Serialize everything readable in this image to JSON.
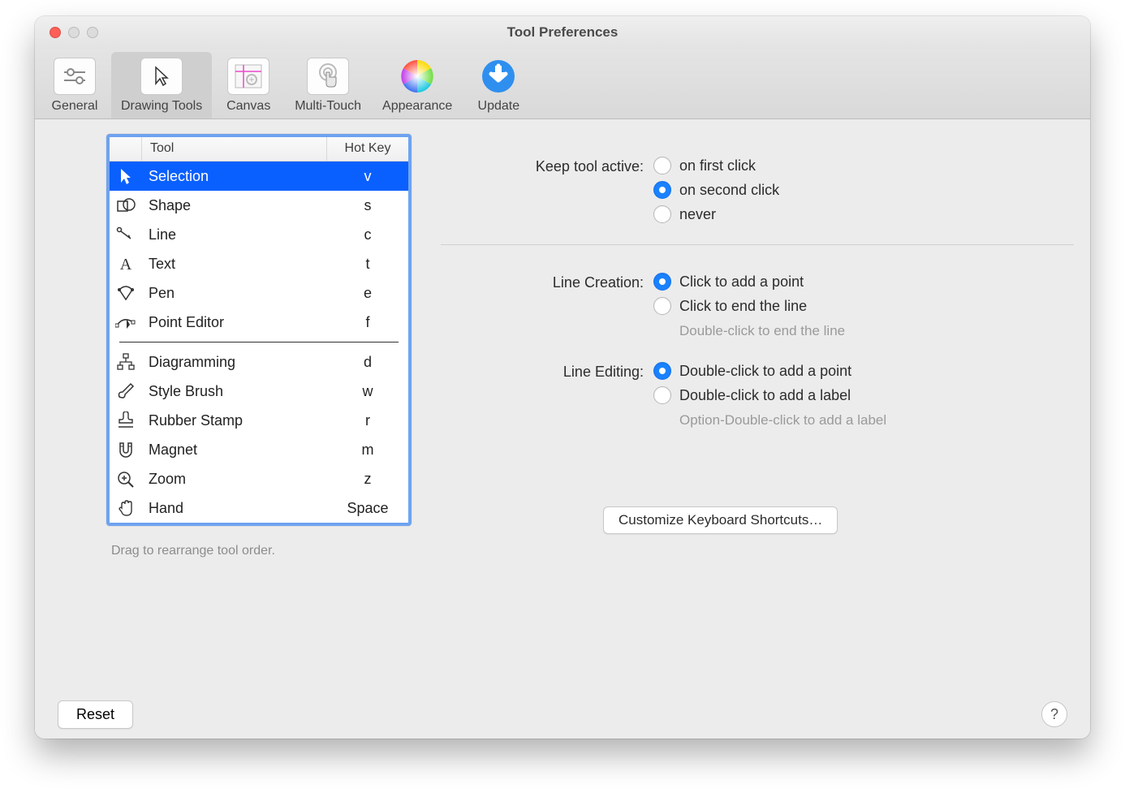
{
  "window": {
    "title": "Tool Preferences"
  },
  "toolbar": {
    "tabs": [
      {
        "id": "general",
        "label": "General"
      },
      {
        "id": "drawingtools",
        "label": "Drawing Tools",
        "selected": true
      },
      {
        "id": "canvas",
        "label": "Canvas"
      },
      {
        "id": "multitouch",
        "label": "Multi-Touch"
      },
      {
        "id": "appearance",
        "label": "Appearance"
      },
      {
        "id": "update",
        "label": "Update"
      }
    ]
  },
  "tool_list": {
    "header_tool": "Tool",
    "header_hotkey": "Hot Key",
    "rows": [
      {
        "name": "Selection",
        "hotkey": "v",
        "icon": "selection",
        "selected": true
      },
      {
        "name": "Shape",
        "hotkey": "s",
        "icon": "shape"
      },
      {
        "name": "Line",
        "hotkey": "c",
        "icon": "line"
      },
      {
        "name": "Text",
        "hotkey": "t",
        "icon": "text"
      },
      {
        "name": "Pen",
        "hotkey": "e",
        "icon": "pen"
      },
      {
        "name": "Point Editor",
        "hotkey": "f",
        "icon": "point-editor"
      },
      {
        "separator": true
      },
      {
        "name": "Diagramming",
        "hotkey": "d",
        "icon": "diagram"
      },
      {
        "name": "Style Brush",
        "hotkey": "w",
        "icon": "style-brush"
      },
      {
        "name": "Rubber Stamp",
        "hotkey": "r",
        "icon": "stamp"
      },
      {
        "name": "Magnet",
        "hotkey": "m",
        "icon": "magnet"
      },
      {
        "name": "Zoom",
        "hotkey": "z",
        "icon": "zoom"
      },
      {
        "name": "Hand",
        "hotkey": "Space",
        "icon": "hand"
      }
    ],
    "drag_hint": "Drag to rearrange tool order."
  },
  "settings": {
    "keep_tool_active_label": "Keep tool active:",
    "keep_tool_active": {
      "options": [
        {
          "label": "on first click",
          "checked": false
        },
        {
          "label": "on second click",
          "checked": true
        },
        {
          "label": "never",
          "checked": false
        }
      ]
    },
    "line_creation_label": "Line Creation:",
    "line_creation": {
      "options": [
        {
          "label": "Click to add a point",
          "checked": true
        },
        {
          "label": "Click to end the line",
          "checked": false
        }
      ],
      "hint": "Double-click to end the line"
    },
    "line_editing_label": "Line Editing:",
    "line_editing": {
      "options": [
        {
          "label": "Double-click to add a point",
          "checked": true
        },
        {
          "label": "Double-click to add a label",
          "checked": false
        }
      ],
      "hint": "Option-Double-click to add a label"
    },
    "customize_button": "Customize Keyboard Shortcuts…"
  },
  "footer": {
    "reset": "Reset",
    "help": "?"
  }
}
